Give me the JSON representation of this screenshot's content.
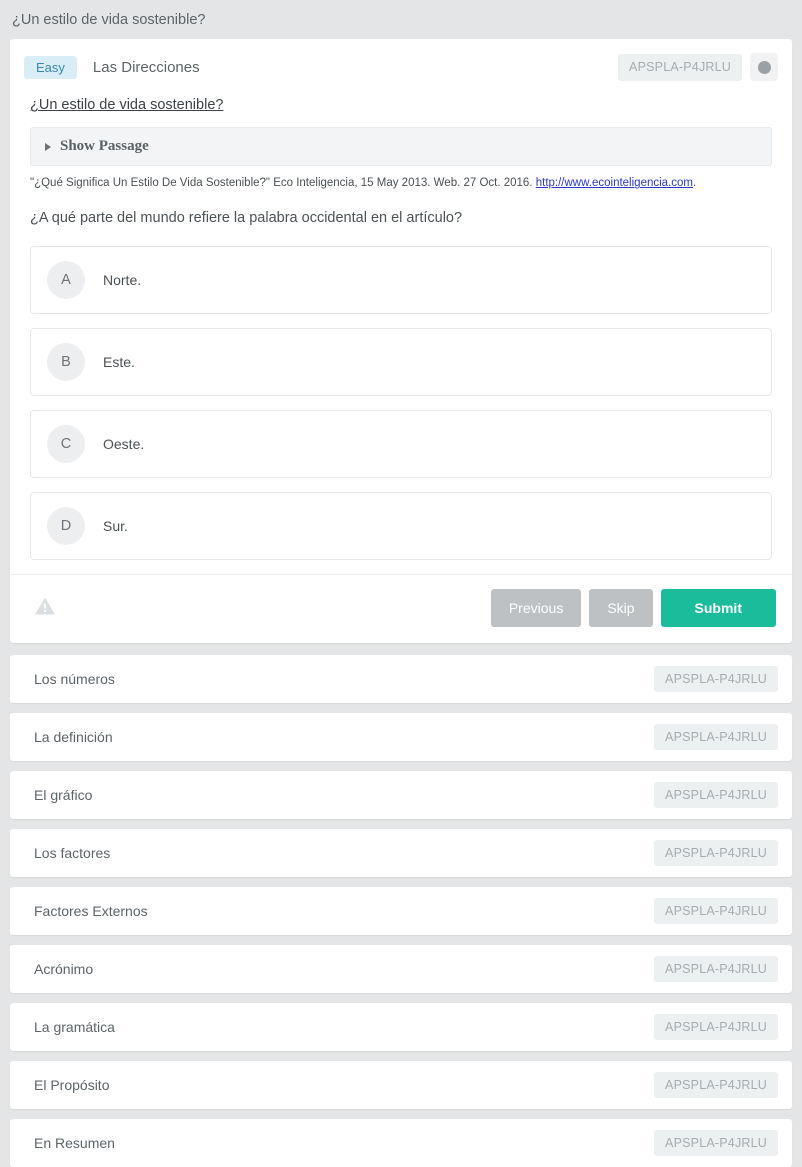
{
  "page": {
    "title": "¿Un estilo de vida sostenible?"
  },
  "question_card": {
    "difficulty_badge": "Easy",
    "section_title": "Las Direcciones",
    "code_badge": "APSPLA-P4JRLU",
    "toggle_icon": "circle-dot-icon",
    "question_link": "¿Un estilo de vida sostenible?",
    "passage_toggle": {
      "label": "Show Passage",
      "icon": "triangle-right-icon"
    },
    "citation": {
      "text_before": "\"¿Qué Significa Un Estilo De Vida Sostenible?\" Eco Inteligencia, 15 May 2013. Web. 27 Oct. 2016. ",
      "link_text": "http://www.ecointeligencia.com",
      "text_after": "."
    },
    "question_text": "¿A qué parte del mundo refiere la palabra occidental en el artículo?",
    "options": [
      {
        "letter": "A",
        "label": "Norte."
      },
      {
        "letter": "B",
        "label": "Este."
      },
      {
        "letter": "C",
        "label": "Oeste."
      },
      {
        "letter": "D",
        "label": "Sur."
      }
    ],
    "warning_icon": "warning-triangle-icon",
    "buttons": {
      "previous": "Previous",
      "skip": "Skip",
      "submit": "Submit"
    }
  },
  "list": {
    "rows": [
      {
        "label": "Los números",
        "code": "APSPLA-P4JRLU"
      },
      {
        "label": "La definición",
        "code": "APSPLA-P4JRLU"
      },
      {
        "label": "El gráfico",
        "code": "APSPLA-P4JRLU"
      },
      {
        "label": "Los factores",
        "code": "APSPLA-P4JRLU"
      },
      {
        "label": "Factores Externos",
        "code": "APSPLA-P4JRLU"
      },
      {
        "label": "Acrónimo",
        "code": "APSPLA-P4JRLU"
      },
      {
        "label": "La gramática",
        "code": "APSPLA-P4JRLU"
      },
      {
        "label": "El Propósito",
        "code": "APSPLA-P4JRLU"
      },
      {
        "label": "En Resumen",
        "code": "APSPLA-P4JRLU"
      }
    ]
  },
  "colors": {
    "page_background": "#e3e5e6",
    "badge_easy_bg": "#d9edf7",
    "badge_easy_text": "#3a87ad",
    "submit_button": "#1abc9c",
    "grey_button": "#bdc1c3",
    "link": "#2b39c6"
  }
}
